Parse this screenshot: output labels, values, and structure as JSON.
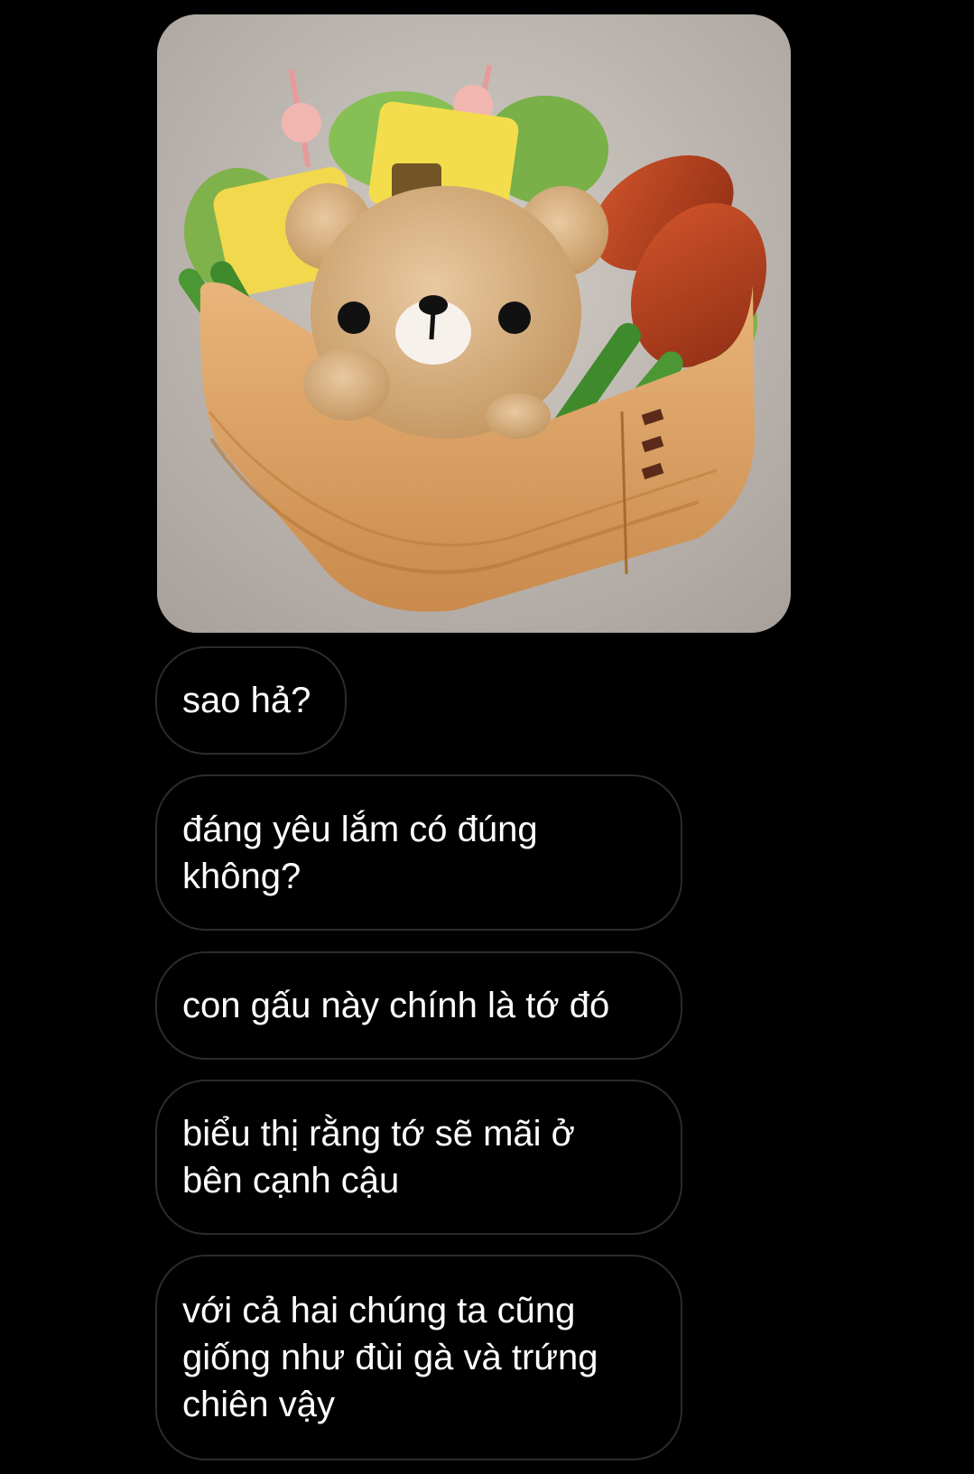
{
  "conversation": {
    "photo": {
      "subject": "bear-rice-bento-icon"
    },
    "messages": [
      {
        "text": "sao hả?"
      },
      {
        "text": "đáng yêu lắm có đúng\nkhông?"
      },
      {
        "text": "con gấu này chính là tớ đó"
      },
      {
        "text": "biểu thị rằng tớ sẽ mãi ở\nbên cạnh cậu"
      },
      {
        "text": "với cả hai chúng ta cũng\ngiống như đùi gà và trứng\nchiên vậy"
      }
    ]
  },
  "colors": {
    "background": "#000000",
    "bubble_border": "#2b2b2b",
    "text": "#ffffff"
  }
}
